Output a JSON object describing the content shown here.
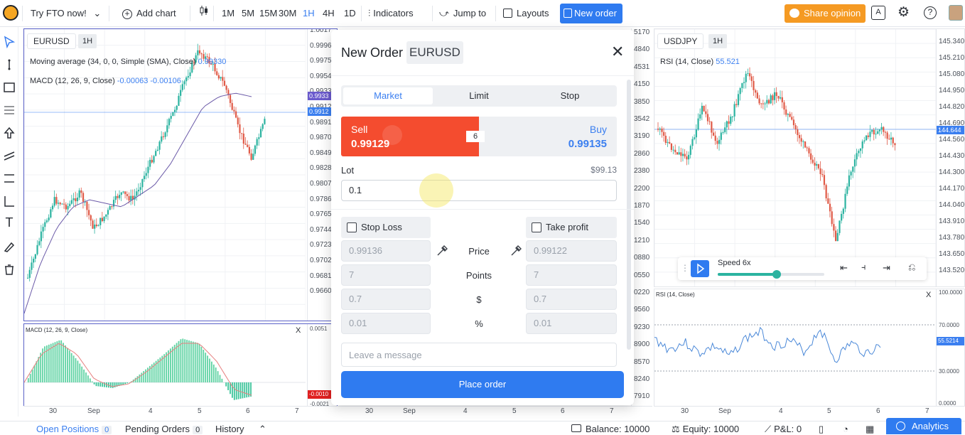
{
  "toolbar": {
    "try_label": "Try FTO now!",
    "add_chart": "Add chart",
    "timeframes": [
      "1M",
      "5M",
      "15M",
      "30M",
      "1H",
      "4H",
      "1D"
    ],
    "active_timeframe": "1H",
    "indicators": "Indicators",
    "jump_to": "Jump to",
    "layouts": "Layouts",
    "new_order": "New order",
    "share_opinion": "Share opinion",
    "ai_label": "A"
  },
  "left_chart": {
    "symbol": "EURUSD",
    "timeframe": "1H",
    "ma_label": "Moving average (34, 0, 0, Simple (SMA), Close)",
    "ma_value": "0.99330",
    "macd_label": "MACD (12, 26, 9, Close)",
    "macd_v1": "-0.00063",
    "macd_v2": "-0.00106",
    "price_labels": [
      "1.0017",
      "0.9996",
      "0.9975",
      "0.9954",
      "0.9933",
      "0.9912",
      "0.9891",
      "0.9870",
      "0.9849",
      "0.9828",
      "0.9807",
      "0.9786",
      "0.9765",
      "0.9744",
      "0.9723",
      "0.9702",
      "0.9681",
      "0.9660"
    ],
    "tag_ma": "0.9933",
    "tag_price": "0.9912",
    "macd_pane_title": "MACD (12, 26, 9, Close)",
    "macd_axis": [
      "0.0051",
      "-0.0010",
      "-0.0021"
    ],
    "time_labels": [
      "30",
      "Sep",
      "4",
      "5",
      "6",
      "7"
    ]
  },
  "middle_axis": {
    "labels": [
      "5170",
      "4840",
      "4531",
      "4150",
      "3850",
      "3542",
      "3190",
      "2860",
      "2380",
      "2200",
      "1870",
      "1540",
      "1210",
      "0880",
      "0550",
      "0220",
      "9560",
      "9230",
      "8900",
      "8570",
      "8240",
      "7910"
    ],
    "time_labels": [
      "30",
      "Sep",
      "4",
      "5",
      "6",
      "7"
    ]
  },
  "right_chart": {
    "symbol": "USDJPY",
    "timeframe": "1H",
    "rsi_label": "RSI (14, Close)",
    "rsi_value": "55.521",
    "price_labels": [
      "145.340",
      "145.210",
      "145.080",
      "144.950",
      "144.820",
      "144.690",
      "144.560",
      "144.430",
      "144.300",
      "144.170",
      "144.040",
      "143.910",
      "143.780",
      "143.650",
      "143.520"
    ],
    "price_tag": "144.644",
    "rsi_pane_title": "RSI (14, Close)",
    "rsi_axis": [
      "100.0000",
      "70.0000",
      "55.5214",
      "30.0000",
      "0.0000"
    ],
    "time_labels": [
      "30",
      "Sep",
      "4",
      "5",
      "6",
      "7"
    ]
  },
  "playback": {
    "speed_label": "Speed 6x",
    "speed_fraction": 0.55
  },
  "modal": {
    "title": "New Order",
    "symbol": "EURUSD",
    "tabs": [
      "Market",
      "Limit",
      "Stop"
    ],
    "active_tab": "Market",
    "sell_label": "Sell",
    "sell_price": "0.99129",
    "buy_label": "Buy",
    "buy_price": "0.99135",
    "spread": "6",
    "lot_label": "Lot",
    "lot_amount": "$99.13",
    "lot_value": "0.1",
    "stop_loss_label": "Stop Loss",
    "take_profit_label": "Take profit",
    "sl_price": "0.99136",
    "sl_points": "7",
    "sl_usd": "0.7",
    "sl_pct": "0.01",
    "tp_price": "0.99122",
    "tp_points": "7",
    "tp_usd": "0.7",
    "tp_pct": "0.01",
    "row_price": "Price",
    "row_points": "Points",
    "row_usd": "$",
    "row_pct": "%",
    "message_placeholder": "Leave a message",
    "place_order": "Place order"
  },
  "bottom": {
    "open_positions": "Open Positions",
    "open_count": "0",
    "pending_orders": "Pending Orders",
    "pending_count": "0",
    "history": "History",
    "balance": "Balance: 10000",
    "equity": "Equity: 10000",
    "pnl": "P&L: 0",
    "analytics": "Analytics"
  },
  "colors": {
    "accent": "#2f7bf0",
    "sell": "#f44c2f",
    "share": "#f59a23",
    "bull": "#2bb3a0",
    "bear": "#e05a47"
  }
}
